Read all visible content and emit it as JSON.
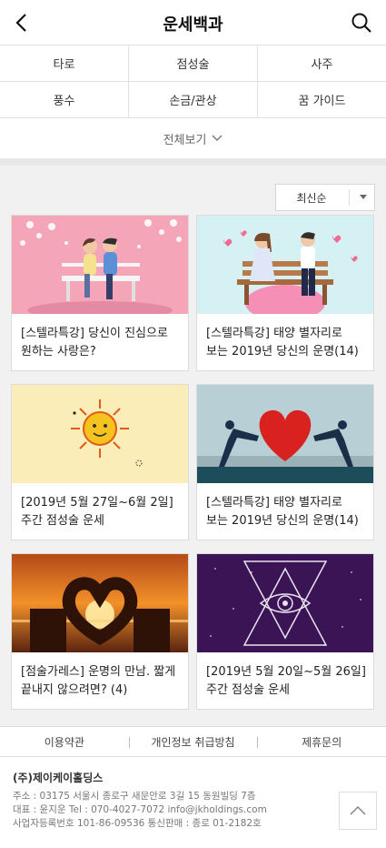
{
  "header": {
    "title": "운세백과"
  },
  "categories": [
    [
      "타로",
      "점성술",
      "사주"
    ],
    [
      "풍수",
      "손금/관상",
      "꿈 가이드"
    ]
  ],
  "view_all": "전체보기",
  "sort": {
    "selected": "최신순"
  },
  "articles": [
    {
      "line1": "[스텔라특강] 당신이 진심으로",
      "line2": "원하는 사랑은?"
    },
    {
      "line1": "[스텔라특강] 태양 별자리로",
      "line2": "보는 2019년 당신의 운명(14)"
    },
    {
      "line1": "[2019년 5월 27일~6월 2일]",
      "line2": "주간 점성술 운세"
    },
    {
      "line1": "[스텔라특강] 태양 별자리로",
      "line2": "보는 2019년 당신의 운명(14)"
    },
    {
      "line1": "[점술가레스] 운명의 만남. 짧게",
      "line2": "끝내지 않으려면? (4)"
    },
    {
      "line1": "[2019년 5월 20일~5월 26일]",
      "line2": "주간 점성술 운세"
    }
  ],
  "footer": {
    "links": [
      "이용약관",
      "개인정보 취급방침",
      "제휴문의"
    ],
    "company": "(주)제이케이홀딩스",
    "address": "주소 : 03175 서울시 종로구 새문안로 3길 15 동원빌딩 7층",
    "contact": "대표 : 윤지운    Tel : 070-4027-7072    info@jkholdings.com",
    "registration": "사업자등록번호 101-86-09536 통신판매 : 종로 01-2182호"
  }
}
